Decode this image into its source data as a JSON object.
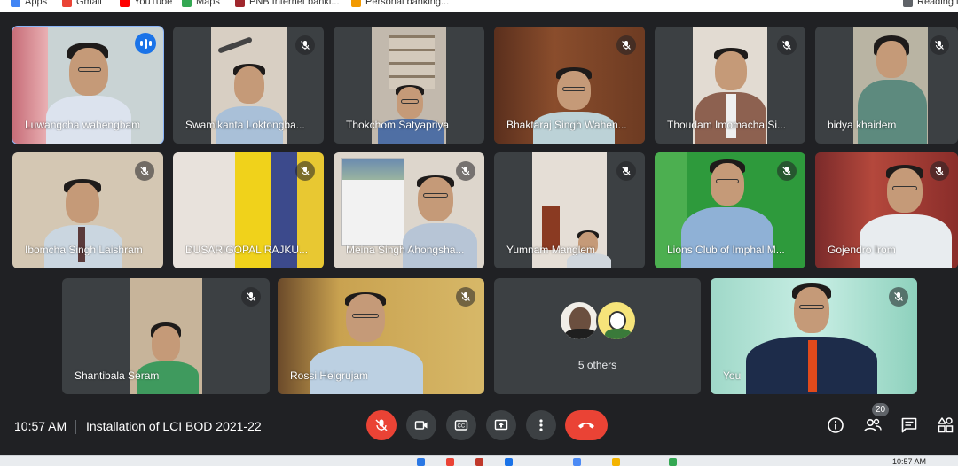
{
  "browser": {
    "bookmarks": [
      {
        "label": "Apps",
        "icon": "apps-grid-icon",
        "color": "#4285f4"
      },
      {
        "label": "Gmail",
        "icon": "gmail-icon",
        "color": "#ea4335"
      },
      {
        "label": "YouTube",
        "icon": "youtube-icon",
        "color": "#ff0000"
      },
      {
        "label": "Maps",
        "icon": "maps-icon",
        "color": "#34a853"
      },
      {
        "label": "PNB Internet banki...",
        "icon": "pnb-bank-icon",
        "color": "#a0272d"
      },
      {
        "label": "Personal banking...",
        "icon": "personal-banking-icon",
        "color": "#f29900"
      },
      {
        "label": "Reading list",
        "icon": "reading-list-icon",
        "color": "#5f6368"
      }
    ]
  },
  "participants": [
    {
      "name": "Luwangcha wahengbam",
      "mic": "speaking"
    },
    {
      "name": "Swamikanta Loktongba...",
      "mic": "muted"
    },
    {
      "name": "Thokchom Satyapriya",
      "mic": "on"
    },
    {
      "name": "Bhaktaraj Singh Wahen...",
      "mic": "muted"
    },
    {
      "name": "Thoudam Imomacha Si...",
      "mic": "muted"
    },
    {
      "name": "bidya khaidem",
      "mic": "muted"
    },
    {
      "name": "Ibomcha Singh Laishram",
      "mic": "muted"
    },
    {
      "name": "DUSARIGOPAL RAJKU...",
      "mic": "muted"
    },
    {
      "name": "Meina Singh Ahongsha...",
      "mic": "muted"
    },
    {
      "name": "Yumnam Manglem",
      "mic": "muted"
    },
    {
      "name": "Lions Club of Imphal M...",
      "mic": "muted"
    },
    {
      "name": "Gojendro Irom",
      "mic": "muted"
    },
    {
      "name": "Shantibala Seram",
      "mic": "muted"
    },
    {
      "name": "Rossi Heigrujam",
      "mic": "muted"
    },
    {
      "name": "You",
      "mic": "muted"
    }
  ],
  "others_tile": {
    "label": "5 others"
  },
  "bottom_bar": {
    "time": "10:57 AM",
    "meeting_title": "Installation of LCI BOD 2021-22",
    "controls": [
      {
        "icon": "mic-off-icon",
        "state": "muted",
        "color": "#ea4335"
      },
      {
        "icon": "camera-icon",
        "state": "on"
      },
      {
        "icon": "captions-icon",
        "state": "off"
      },
      {
        "icon": "present-screen-icon",
        "state": "off"
      },
      {
        "icon": "more-options-icon",
        "state": "off"
      },
      {
        "icon": "hang-up-icon",
        "state": "leave",
        "color": "#ea4335"
      }
    ],
    "people_count": "20"
  },
  "taskbar": {
    "time": "10:57 AM"
  }
}
